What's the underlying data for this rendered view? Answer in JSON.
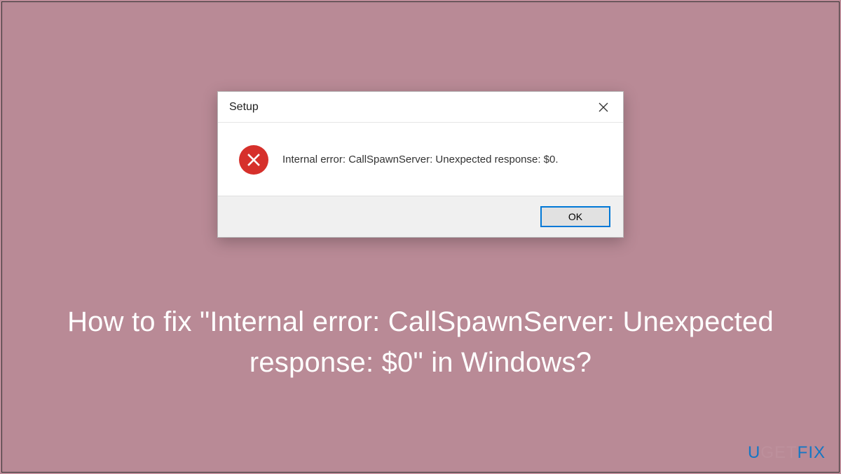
{
  "dialog": {
    "title": "Setup",
    "error_message": "Internal error: CallSpawnServer: Unexpected response: $0.",
    "ok_label": "OK"
  },
  "heading": "How to fix \"Internal error: CallSpawnServer: Unexpected response: $0\" in Windows?",
  "watermark": {
    "part1": "U",
    "part2": "GET",
    "part3": "FIX"
  },
  "colors": {
    "background": "#b98a96",
    "error_icon": "#d6302b",
    "accent": "#0078d7",
    "watermark": "#1577c4"
  }
}
